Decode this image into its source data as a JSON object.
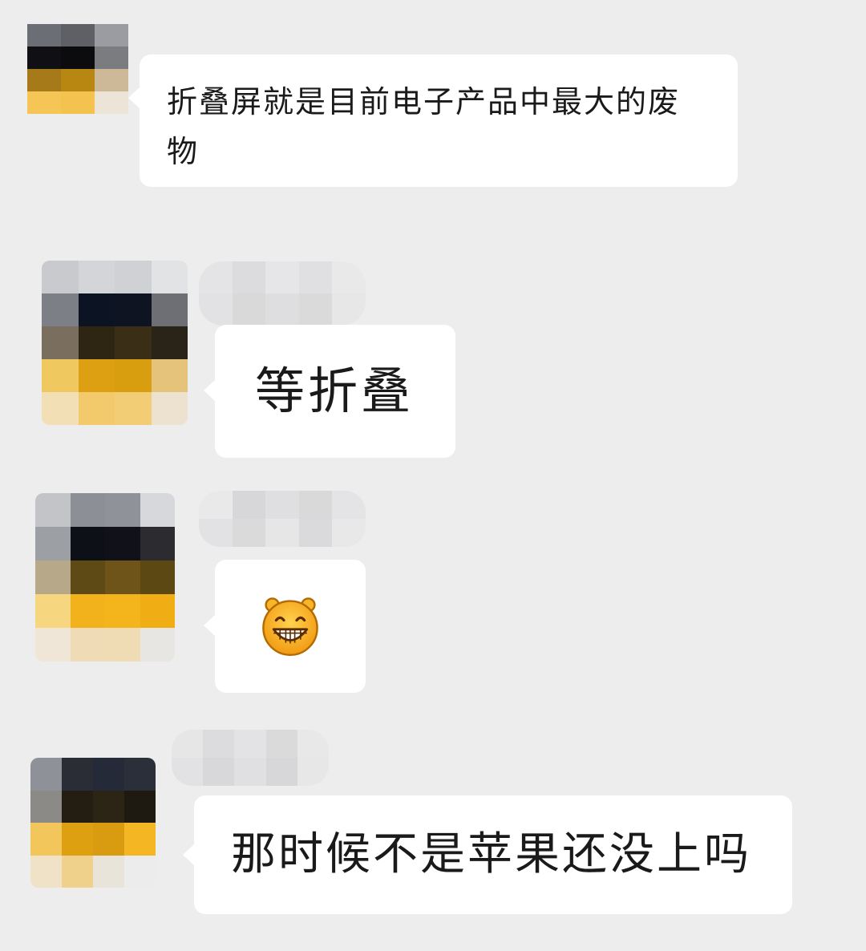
{
  "messages": [
    {
      "sender": "other",
      "text": "折叠屏就是目前电子产品中最大的废物"
    },
    {
      "sender": "other",
      "text": "等折叠"
    },
    {
      "sender": "other",
      "sticker": "grinning-face-emoji"
    },
    {
      "sender": "other",
      "text": "那时候不是苹果还没上吗"
    }
  ],
  "colors": {
    "background": "#ededed",
    "bubble": "#ffffff",
    "text": "#1a1a1a"
  }
}
